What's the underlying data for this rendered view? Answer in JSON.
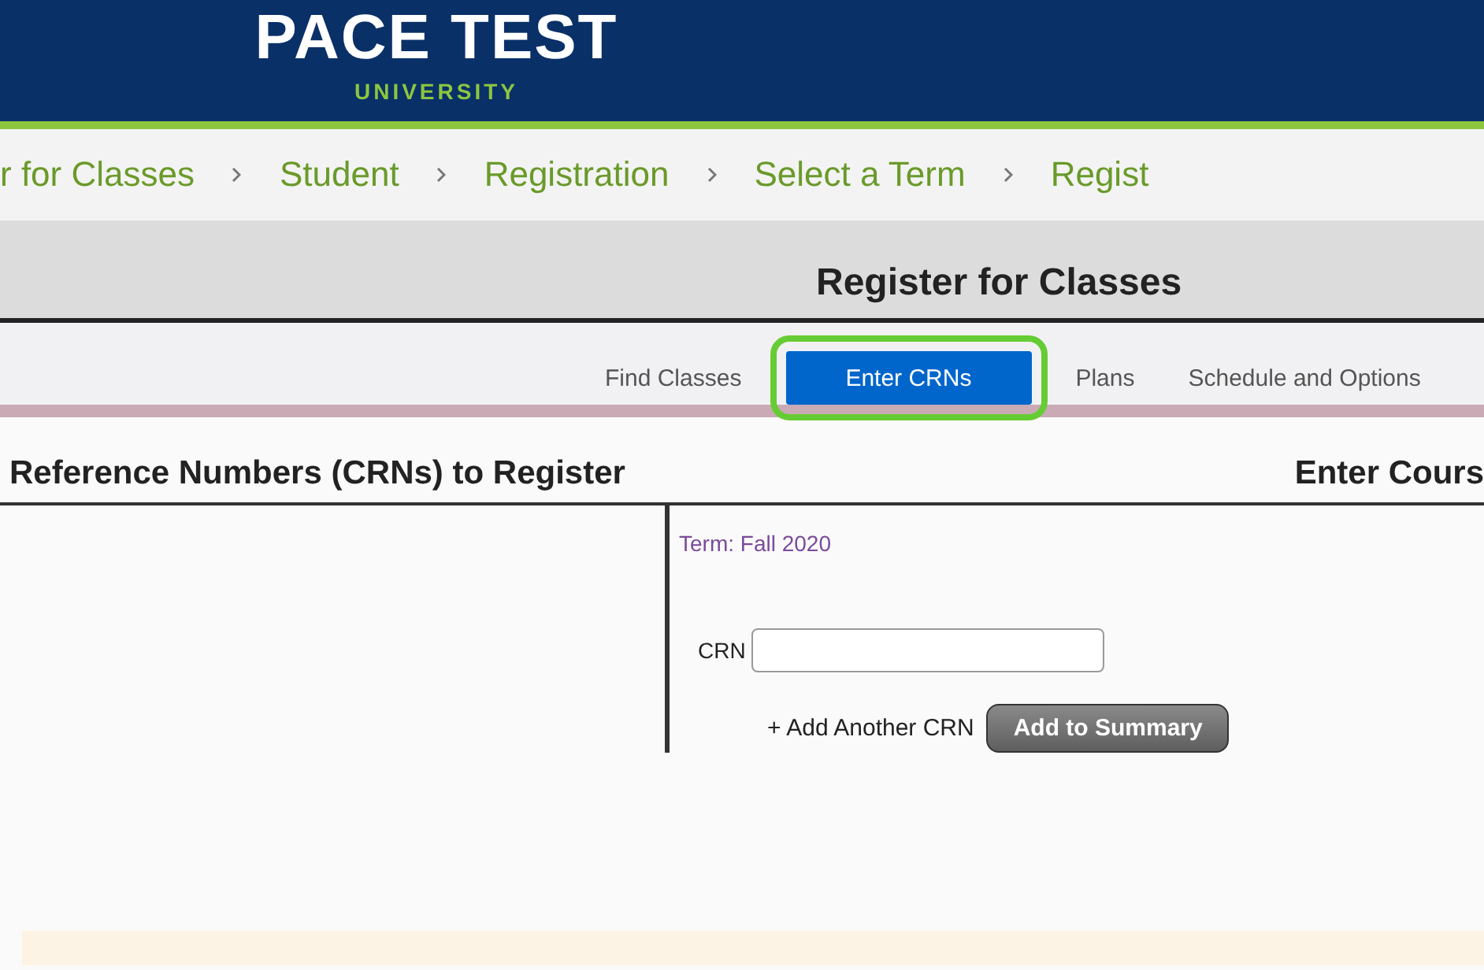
{
  "header": {
    "logo_top": "PACE TEST",
    "logo_bottom": "UNIVERSITY"
  },
  "breadcrumbs": [
    "r for Classes",
    "Student",
    "Registration",
    "Select a Term",
    "Regist"
  ],
  "page_title": "Register for Classes",
  "tabs": [
    {
      "label": "Find Classes",
      "selected": false
    },
    {
      "label": "Enter CRNs",
      "selected": true
    },
    {
      "label": "Plans",
      "selected": false
    },
    {
      "label": "Schedule and Options",
      "selected": false
    }
  ],
  "panels": {
    "left_heading": "Reference Numbers (CRNs) to Register",
    "right_heading": "Enter Cours"
  },
  "form": {
    "term": "Term: Fall 2020",
    "crn_label": "CRN",
    "add_link": "+ Add Another CRN",
    "submit": "Add to Summary"
  }
}
